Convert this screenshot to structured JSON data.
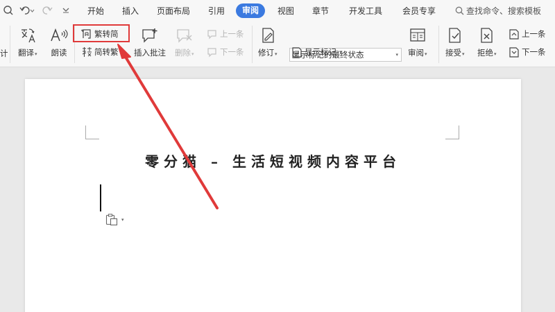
{
  "menubar": {
    "tabs": [
      "开始",
      "插入",
      "页面布局",
      "引用",
      "审阅",
      "视图",
      "章节",
      "开发工具",
      "会员专享"
    ],
    "active_tab": "审阅",
    "search_placeholder": "查找命令、搜索模板"
  },
  "ribbon": {
    "count_label": "计",
    "translate_label": "翻译",
    "read_aloud_label": "朗读",
    "trad_to_simp_label": "繁转简",
    "simp_to_trad_label": "简转繁",
    "insert_comment_label": "插入批注",
    "delete_label": "删除",
    "prev_comment_label": "上一条",
    "next_comment_label": "下一条",
    "track_changes_label": "修订",
    "markup_display_value": "显示标记的最终状态",
    "show_markup_label": "显示标记",
    "review_pane_label": "审阅",
    "accept_label": "接受",
    "reject_label": "拒绝",
    "prev_change_label": "上一条",
    "next_change_label": "下一条"
  },
  "document": {
    "title": "零分猫 – 生活短视频内容平台"
  },
  "colors": {
    "accent": "#3b7ae0",
    "annotation": "#e03a3a"
  }
}
